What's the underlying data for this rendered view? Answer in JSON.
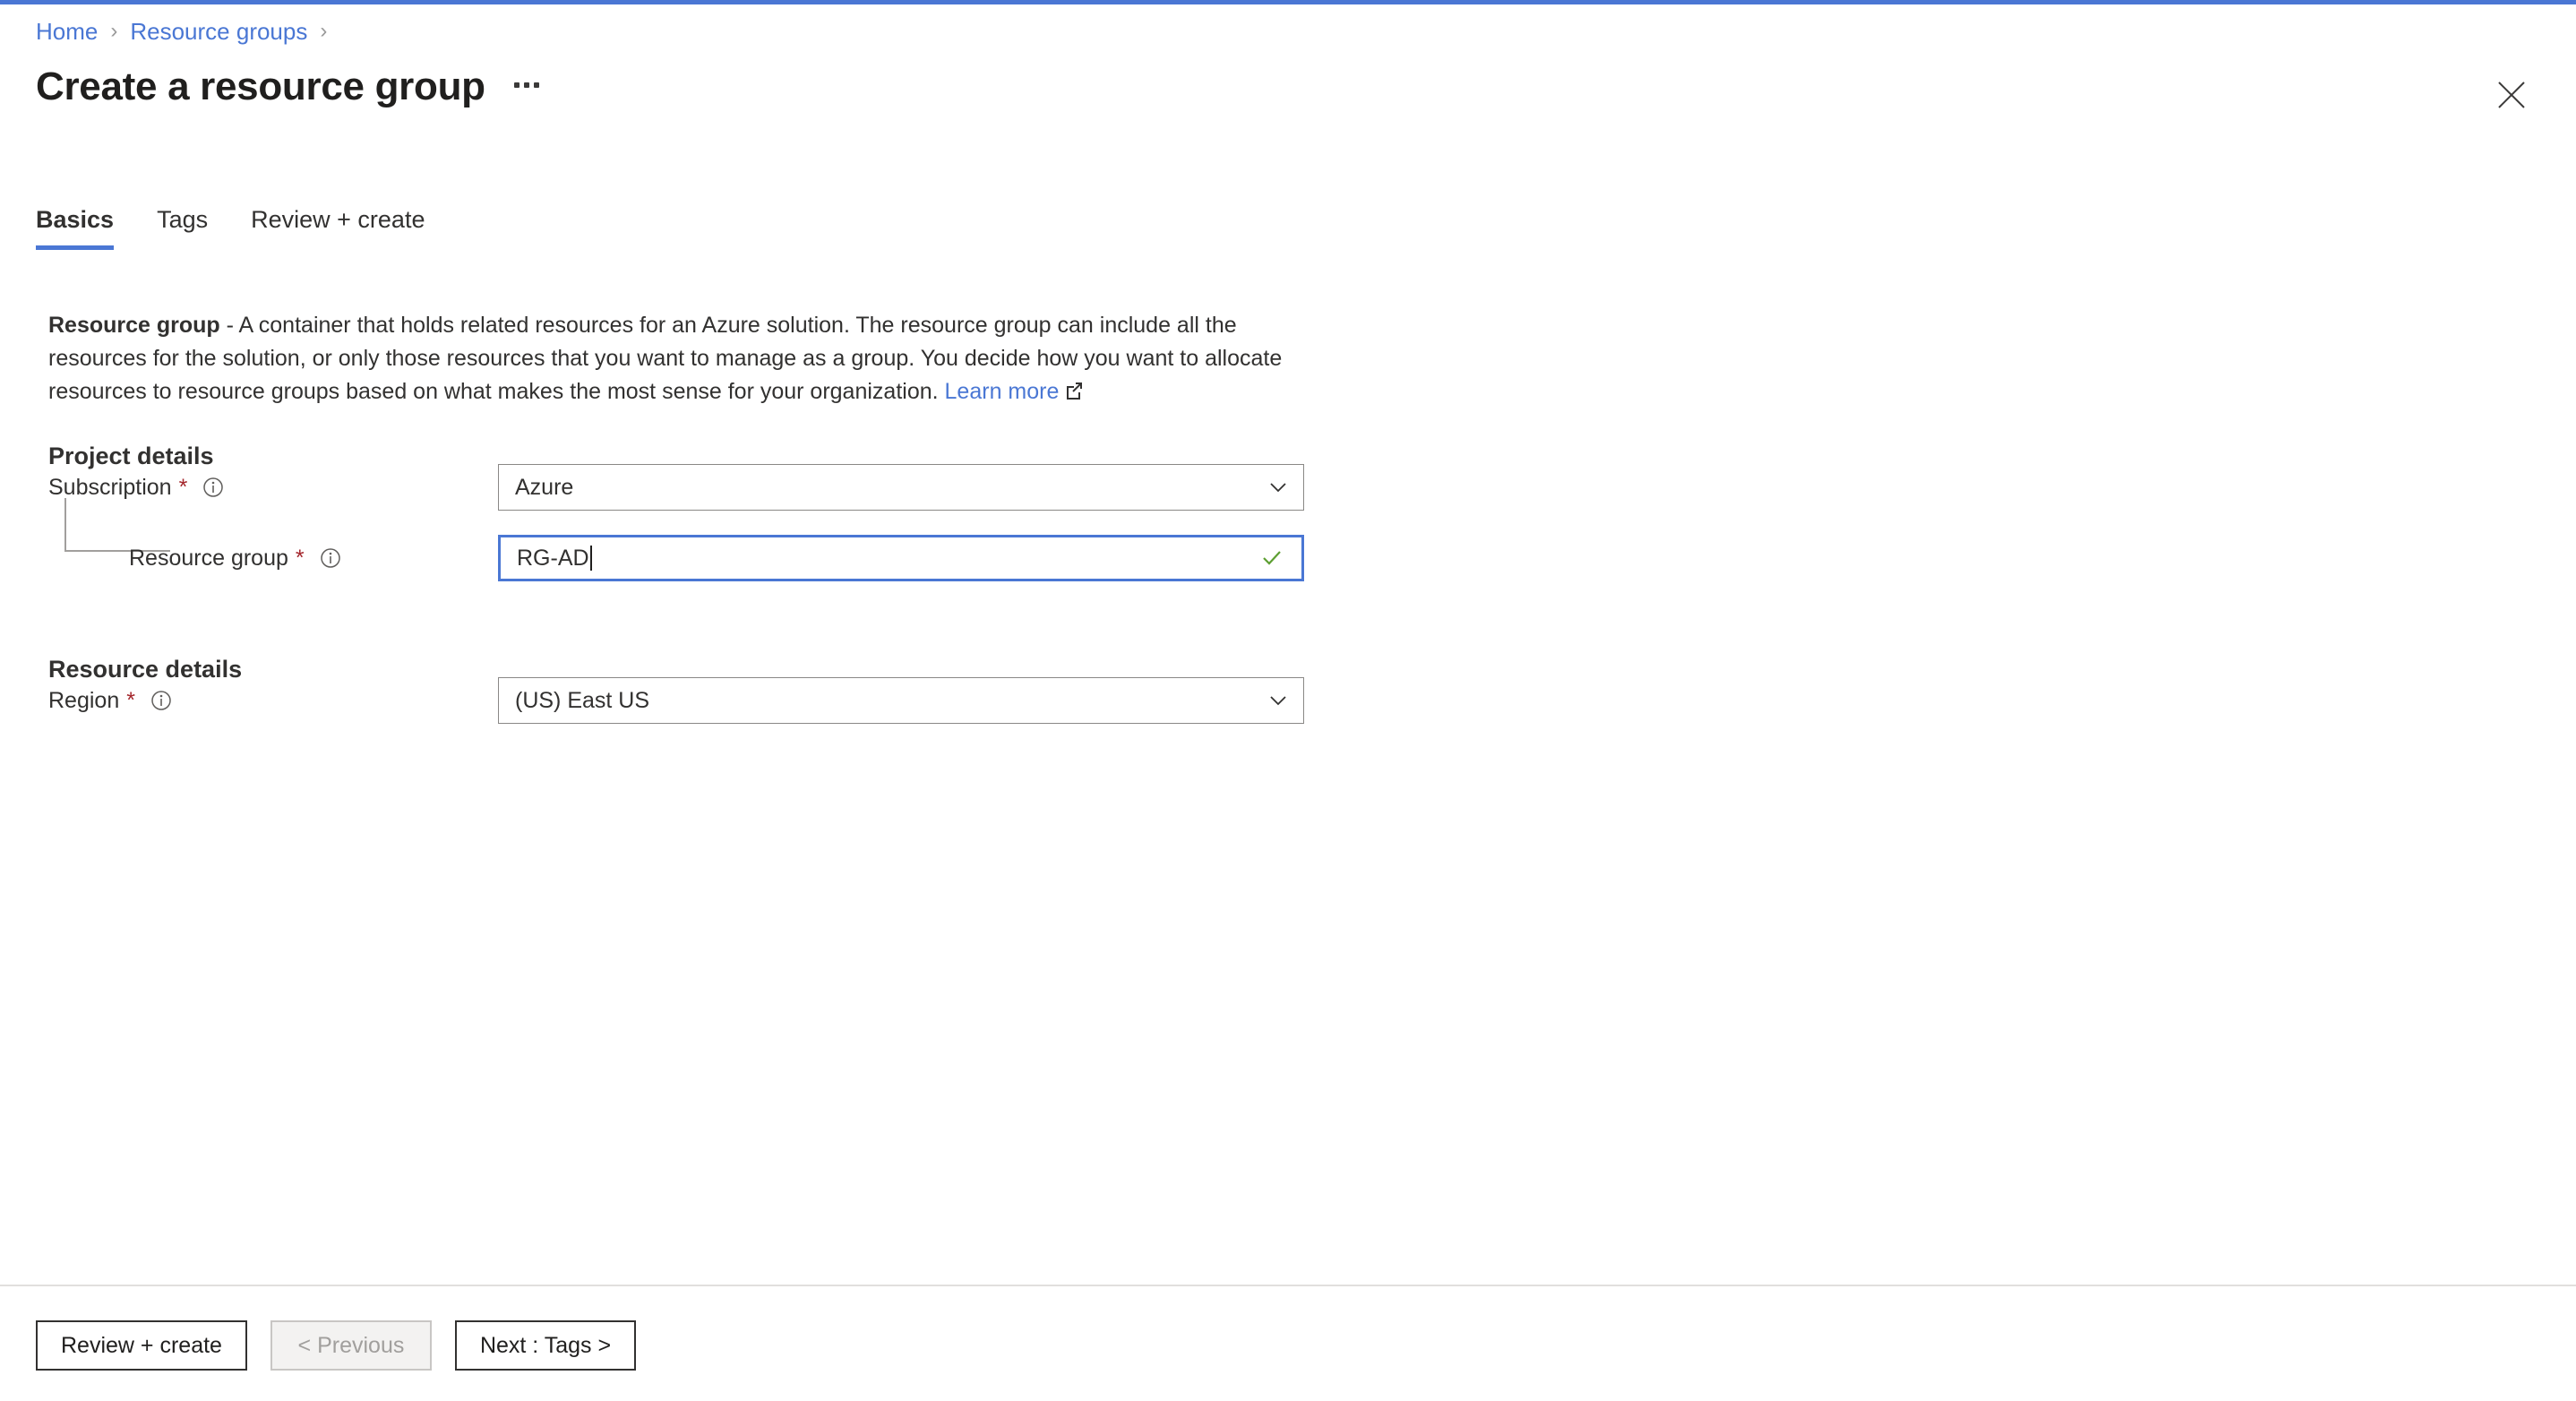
{
  "theme": {
    "accent": "#4a77d4",
    "link": "#4a77d4",
    "required_star": "#a4262c",
    "valid_check": "#5d9f32",
    "border": "#8a8886",
    "text": "#323130"
  },
  "breadcrumb": {
    "items": [
      {
        "label": "Home"
      },
      {
        "label": "Resource groups"
      }
    ],
    "separator": "›"
  },
  "header": {
    "title": "Create a resource group",
    "more_menu": "…",
    "close_label": "Close"
  },
  "tabs": [
    {
      "label": "Basics",
      "active": true
    },
    {
      "label": "Tags",
      "active": false
    },
    {
      "label": "Review + create",
      "active": false
    }
  ],
  "description": {
    "lead": "Resource group",
    "body": " - A container that holds related resources for an Azure solution. The resource group can include all the resources for the solution, or only those resources that you want to manage as a group. You decide how you want to allocate resources to resource groups based on what makes the most sense for your organization. ",
    "link_label": "Learn more"
  },
  "sections": {
    "project_details": {
      "title": "Project details",
      "fields": {
        "subscription": {
          "label": "Subscription",
          "required_mark": "*",
          "value": "Azure",
          "type": "select"
        },
        "resource_group": {
          "label": "Resource group",
          "required_mark": "*",
          "value": "RG-AD",
          "type": "text",
          "focused": true,
          "validated": true
        }
      }
    },
    "resource_details": {
      "title": "Resource details",
      "fields": {
        "region": {
          "label": "Region",
          "required_mark": "*",
          "value": "(US) East US",
          "type": "select"
        }
      }
    }
  },
  "footer": {
    "review_create": "Review + create",
    "previous": "< Previous",
    "next": "Next : Tags >"
  }
}
